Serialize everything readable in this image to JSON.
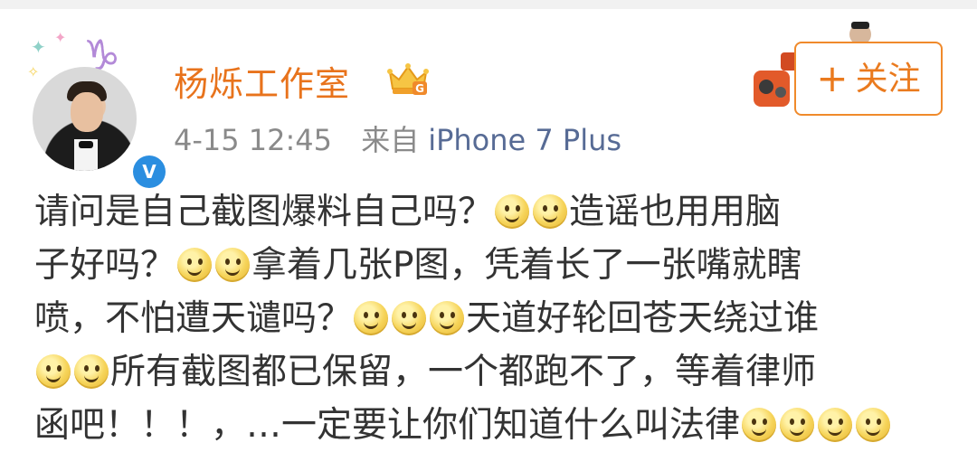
{
  "header": {
    "account_name": "杨烁工作室",
    "membership_badge": "crown-g-icon",
    "verified_icon": "verified-v-icon",
    "verified_label": "V",
    "timestamp": "4-15 12:45",
    "source_prefix": "来自",
    "source_device": "iPhone 7 Plus"
  },
  "follow": {
    "label": "关注",
    "plus": "+"
  },
  "post": {
    "lines": [
      [
        "请问是自己截图爆料自己吗？",
        "EMO",
        "EMO",
        "造谣也用用脑"
      ],
      [
        "子好吗？",
        "EMO",
        "EMO",
        "拿着几张P图，凭着长了一张嘴就瞎"
      ],
      [
        "喷，不怕遭天谴吗？",
        "EMO",
        "EMO",
        "EMO",
        "天道好轮回苍天绕过谁"
      ],
      [
        "EMO",
        "EMO",
        "所有截图都已保留，一个都跑不了，等着律师"
      ],
      [
        "函吧！！！，…一定要让你们知道什么叫法律",
        "EMO",
        "EMO",
        "EMO",
        "EMO"
      ]
    ],
    "line_1": "请问是自己截图爆料自己吗？",
    "line_1b": "造谣也用用脑",
    "line_2": "子好吗？",
    "line_2b": "拿着几张P图，凭着长了一张嘴就瞎",
    "line_3": "喷，不怕遭天谴吗？",
    "line_3b": "天道好轮回苍天绕过谁",
    "line_4": "所有截图都已保留，一个都跑不了，等着律师",
    "line_5": "函吧！！！，…一定要让你们知道什么叫法律"
  },
  "colors": {
    "name": "#e8731c",
    "follow_border": "#f08a2b",
    "source": "#576b95",
    "meta": "#8a8a8a",
    "verified": "#2b8ee0"
  }
}
